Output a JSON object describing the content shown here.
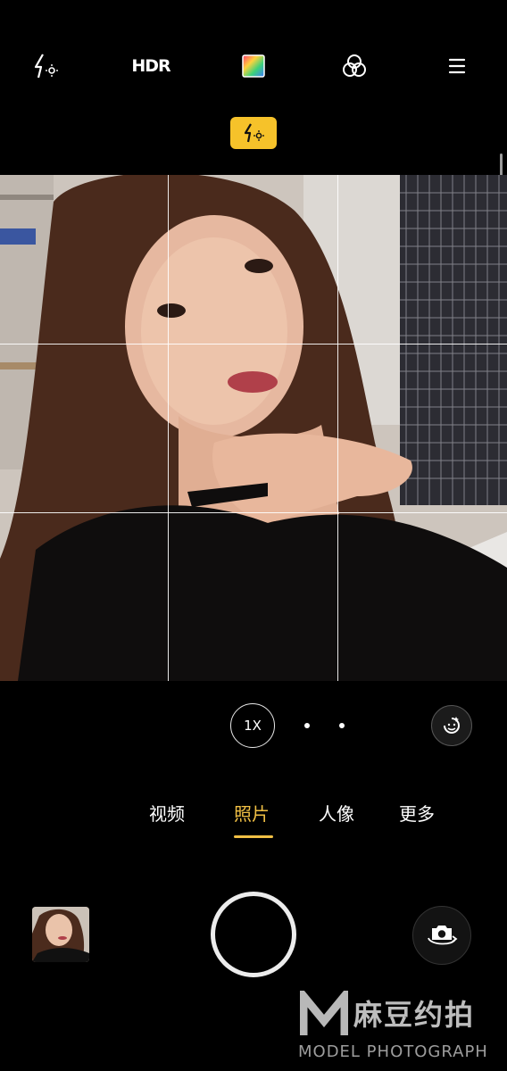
{
  "top_bar": {
    "icons": [
      "flash-auto-icon",
      "hdr-icon",
      "color-filter-icon",
      "filters-icon",
      "menu-icon"
    ],
    "hdr_label": "HDR"
  },
  "flash_badge": {
    "icon": "flash-auto-icon",
    "color": "#f6c22a"
  },
  "zoom": {
    "label": "1X"
  },
  "modes": [
    {
      "label": "视频",
      "active": false
    },
    {
      "label": "照片",
      "active": true
    },
    {
      "label": "人像",
      "active": false
    },
    {
      "label": "更多",
      "active": false
    }
  ],
  "accent_color": "#f1c045",
  "watermark": {
    "cn": "麻豆约拍",
    "en": "MODEL PHOTOGRAPH"
  }
}
